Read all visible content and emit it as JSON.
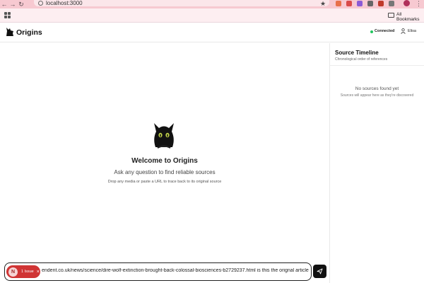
{
  "browser": {
    "url": "localhost:3000",
    "bookmarks_label": "All Bookmarks",
    "back_glyph": "←",
    "forward_glyph": "→",
    "reload_glyph": "↻",
    "star_glyph": "★",
    "menu_glyph": "⋮"
  },
  "header": {
    "app_title": "Origins",
    "status_text": "Connected",
    "user_name": "Elisa",
    "status_color": "#22c55e"
  },
  "welcome": {
    "title": "Welcome to Origins",
    "subtitle": "Ask any question to find reliable sources",
    "hint": "Drop any media or paste a URL to trace back to its original source"
  },
  "sidebar": {
    "title": "Source Timeline",
    "subtitle": "Chronological order of references",
    "empty_title": "No sources found yet",
    "empty_subtitle": "Sources will appear here as they're discovered"
  },
  "input": {
    "value": "endent.co.uk/news/science/dire-wolf-extinction-brought-back-colossal-biosciences-b2729237.html is this the orignal article about this t"
  },
  "issue_badge": {
    "letter": "N",
    "label": "1 Issue",
    "close_glyph": "×",
    "color": "#d03434"
  }
}
